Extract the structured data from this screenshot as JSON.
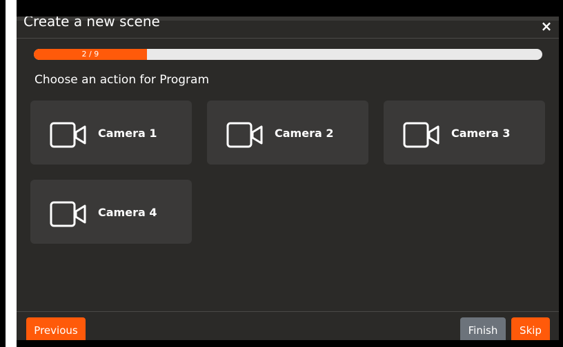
{
  "dialog": {
    "title": "Create a new scene",
    "close_symbol": "×",
    "progress": {
      "text": "2 / 9",
      "current": 2,
      "total": 9
    },
    "heading": "Choose an action for Program"
  },
  "options": [
    {
      "label": "Camera 1",
      "icon": "video-camera-icon"
    },
    {
      "label": "Camera 2",
      "icon": "video-camera-icon"
    },
    {
      "label": "Camera 3",
      "icon": "video-camera-icon"
    },
    {
      "label": "Camera 4",
      "icon": "video-camera-icon"
    }
  ],
  "footer": {
    "previous_label": "Previous",
    "finish_label": "Finish",
    "skip_label": "Skip"
  },
  "colors": {
    "accent": "#ff5a0a",
    "dialog_bg": "#2b2a28",
    "card_bg": "#3a3938",
    "finish_bg": "#6c737b"
  }
}
